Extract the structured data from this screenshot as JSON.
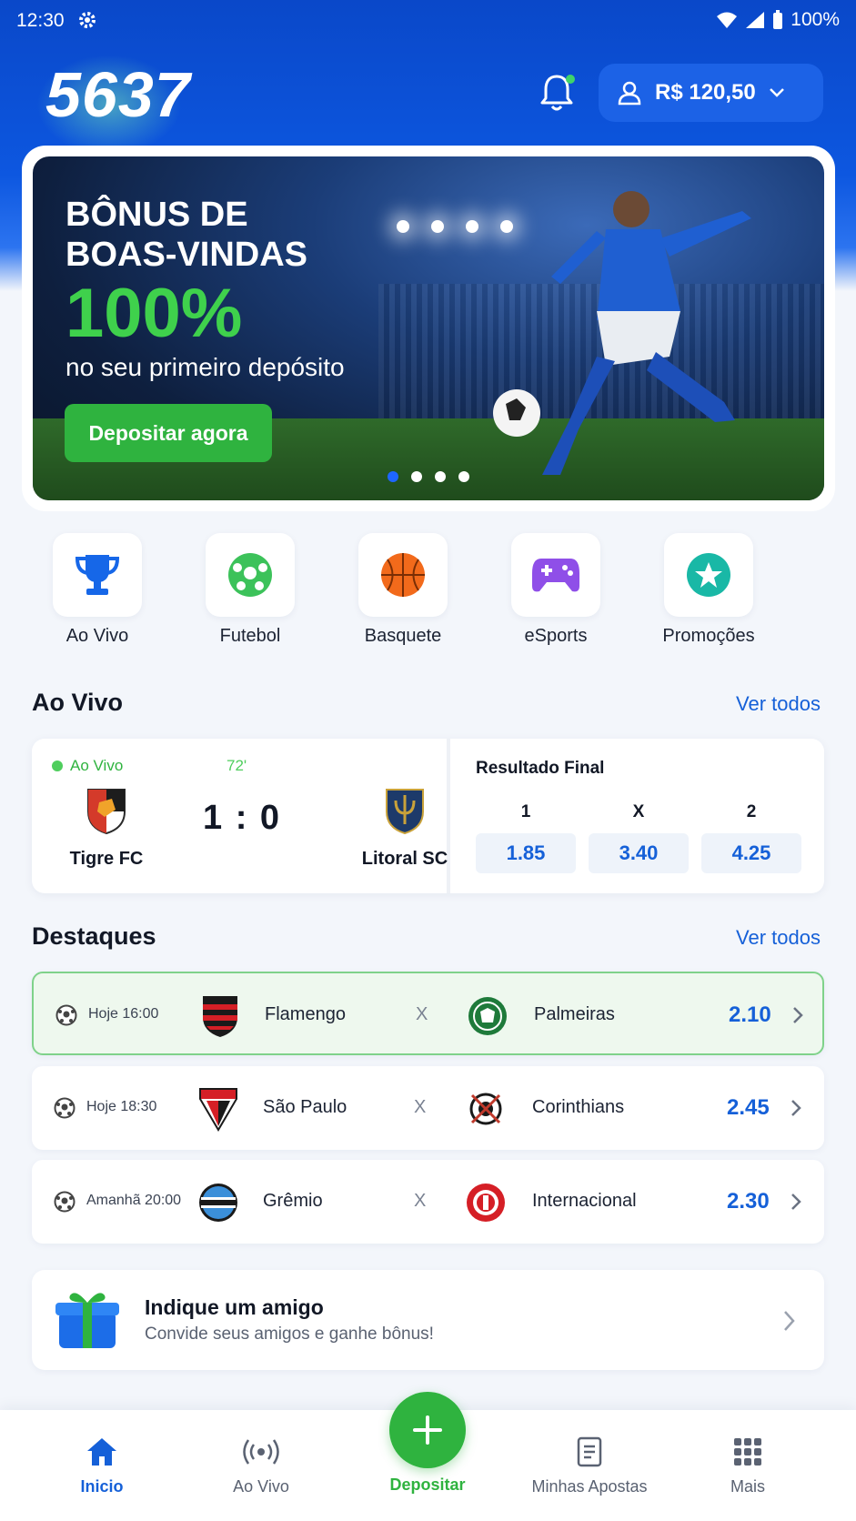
{
  "status_bar": {
    "time": "12:30",
    "battery": "100%"
  },
  "header": {
    "logo": "5637",
    "balance": "R$ 120,50"
  },
  "banner": {
    "title_line1": "BÔNUS DE",
    "title_line2": "BOAS-VINDAS",
    "percent": "100%",
    "subtitle": "no seu primeiro depósito",
    "cta": "Depositar agora",
    "slides": 4,
    "active_slide": 1
  },
  "categories": [
    {
      "label": "Ao Vivo",
      "icon": "trophy-icon"
    },
    {
      "label": "Futebol",
      "icon": "soccer-ball-icon"
    },
    {
      "label": "Basquete",
      "icon": "basketball-icon"
    },
    {
      "label": "eSports",
      "icon": "gamepad-icon"
    },
    {
      "label": "Promoções",
      "icon": "star-badge-icon"
    }
  ],
  "live_section": {
    "title": "Ao Vivo",
    "see_all": "Ver todos",
    "match": {
      "status": "Ao Vivo",
      "minute": "72'",
      "home": "Tigre FC",
      "away": "Litoral SC",
      "score": "1 : 0",
      "market": "Resultado Final",
      "odds": [
        {
          "label": "1",
          "value": "1.85"
        },
        {
          "label": "X",
          "value": "3.40"
        },
        {
          "label": "2",
          "value": "4.25"
        }
      ]
    }
  },
  "highlights": {
    "title": "Destaques",
    "see_all": "Ver todos",
    "separator": "X",
    "matches": [
      {
        "time": "Hoje 16:00",
        "home": "Flamengo",
        "away": "Palmeiras",
        "odd": "2.10",
        "highlighted": true
      },
      {
        "time": "Hoje 18:30",
        "home": "São Paulo",
        "away": "Corinthians",
        "odd": "2.45",
        "highlighted": false
      },
      {
        "time": "Amanhã 20:00",
        "home": "Grêmio",
        "away": "Internacional",
        "odd": "2.30",
        "highlighted": false
      }
    ]
  },
  "referral": {
    "title": "Indique um amigo",
    "subtitle": "Convide seus amigos e ganhe bônus!"
  },
  "bottom_nav": {
    "items": [
      {
        "label": "Inicio",
        "icon": "home-icon",
        "active": true
      },
      {
        "label": "Ao Vivo",
        "icon": "broadcast-icon",
        "active": false
      },
      {
        "label": "Depositar",
        "icon": "plus-icon",
        "active": false
      },
      {
        "label": "Minhas Apostas",
        "icon": "receipt-icon",
        "active": false
      },
      {
        "label": "Mais",
        "icon": "grid-icon",
        "active": false
      }
    ]
  },
  "colors": {
    "primary": "#0d57e0",
    "accent_green": "#2fb33f",
    "link_blue": "#1560d8"
  }
}
